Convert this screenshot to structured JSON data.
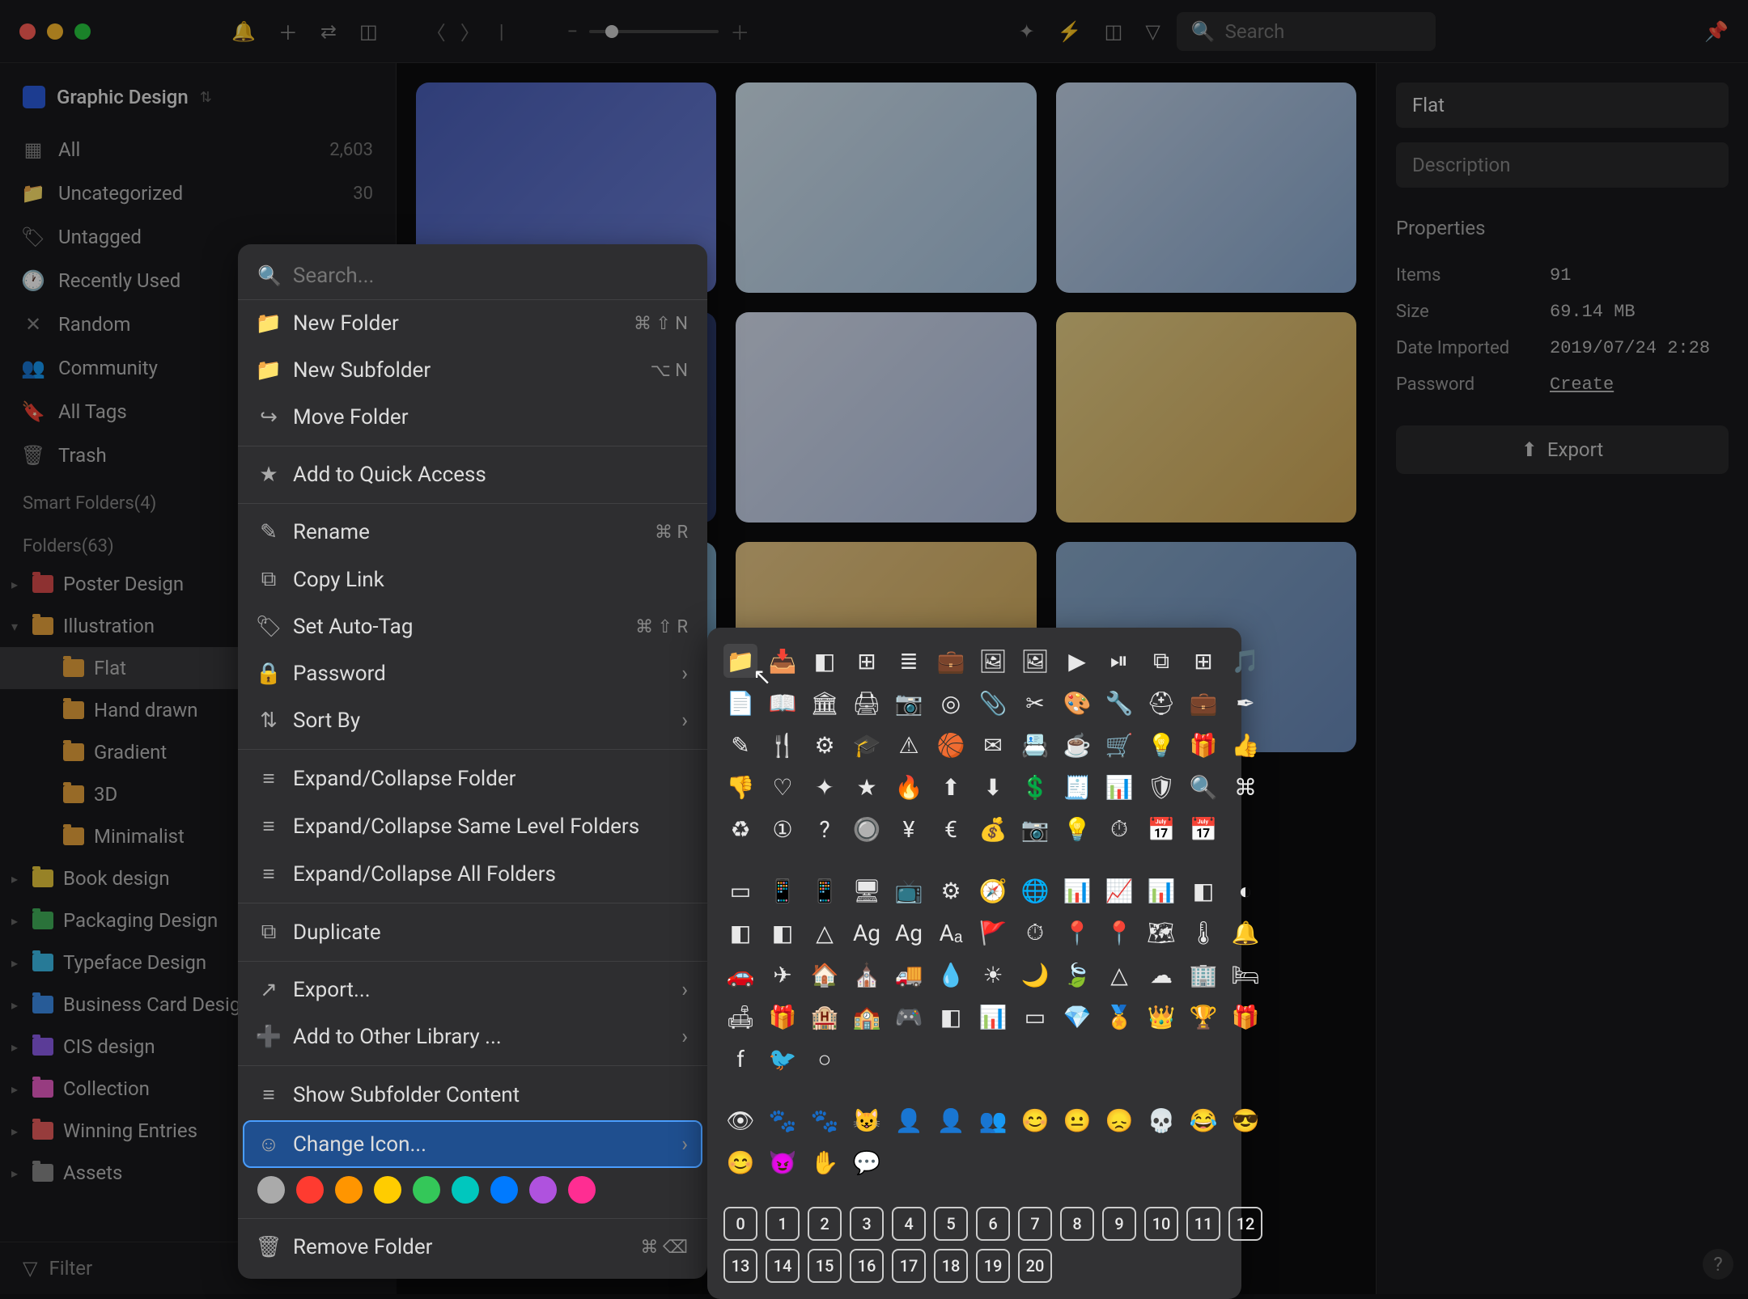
{
  "workspace": {
    "name": "Graphic Design"
  },
  "sidebar": {
    "items": [
      {
        "label": "All",
        "count": "2,603"
      },
      {
        "label": "Uncategorized",
        "count": "30"
      },
      {
        "label": "Untagged",
        "count": ""
      },
      {
        "label": "Recently Used",
        "count": ""
      },
      {
        "label": "Random",
        "count": ""
      },
      {
        "label": "Community",
        "count": ""
      },
      {
        "label": "All Tags",
        "count": ""
      },
      {
        "label": "Trash",
        "count": ""
      }
    ],
    "smart_label": "Smart Folders(4)",
    "folders_label": "Folders(63)",
    "folders": [
      {
        "label": "Poster Design",
        "color": "#d94c4c",
        "nested": false
      },
      {
        "label": "Illustration",
        "color": "#e8a33d",
        "nested": false,
        "expanded": true
      },
      {
        "label": "Flat",
        "color": "#e8a33d",
        "nested": true,
        "selected": true
      },
      {
        "label": "Hand drawn",
        "color": "#e8a33d",
        "nested": true
      },
      {
        "label": "Gradient",
        "color": "#e8a33d",
        "nested": true
      },
      {
        "label": "3D",
        "color": "#e8a33d",
        "nested": true
      },
      {
        "label": "Minimalist",
        "color": "#e8a33d",
        "nested": true
      },
      {
        "label": "Book design",
        "color": "#e8c83d",
        "nested": false
      },
      {
        "label": "Packaging Design",
        "color": "#41b05a",
        "nested": false
      },
      {
        "label": "Typeface Design",
        "color": "#3dbce8",
        "nested": false
      },
      {
        "label": "Business Card Design",
        "color": "#3d8de8",
        "nested": false
      },
      {
        "label": "CIS design",
        "color": "#8c5de8",
        "nested": false
      },
      {
        "label": "Collection",
        "color": "#e85dc5",
        "nested": false
      },
      {
        "label": "Winning Entries",
        "color": "#e85d5d",
        "nested": false
      },
      {
        "label": "Assets",
        "color": "#888",
        "nested": false
      }
    ],
    "filter_label": "Filter"
  },
  "search": {
    "placeholder": "Search"
  },
  "details": {
    "title": "Flat",
    "description_placeholder": "Description",
    "props_head": "Properties",
    "items_k": "Items",
    "items_v": "91",
    "size_k": "Size",
    "size_v": "69.14 MB",
    "date_k": "Date Imported",
    "date_v": "2019/07/24 2:28",
    "pwd_k": "Password",
    "pwd_v": "Create",
    "export_label": "Export"
  },
  "context_menu": {
    "search_placeholder": "Search...",
    "rows": [
      {
        "label": "New Folder",
        "sc": "⌘ ⇧ N"
      },
      {
        "label": "New Subfolder",
        "sc": "⌥ N"
      },
      {
        "label": "Move Folder"
      },
      {
        "sep": true
      },
      {
        "label": "Add to Quick Access"
      },
      {
        "sep": true
      },
      {
        "label": "Rename",
        "sc": "⌘ R"
      },
      {
        "label": "Copy Link"
      },
      {
        "label": "Set Auto-Tag",
        "sc": "⌘ ⇧ R"
      },
      {
        "label": "Password",
        "sub": true
      },
      {
        "label": "Sort By",
        "sub": true
      },
      {
        "sep": true
      },
      {
        "label": "Expand/Collapse Folder"
      },
      {
        "label": "Expand/Collapse Same Level Folders"
      },
      {
        "label": "Expand/Collapse All Folders"
      },
      {
        "sep": true
      },
      {
        "label": "Duplicate"
      },
      {
        "sep": true
      },
      {
        "label": "Export...",
        "sub": true
      },
      {
        "label": "Add to Other Library ...",
        "sub": true
      },
      {
        "sep": true
      },
      {
        "label": "Show Subfolder Content"
      },
      {
        "label": "Change Icon...",
        "sub": true,
        "active": true
      },
      {
        "colors": [
          "#aaa",
          "#ff3b30",
          "#ff9500",
          "#ffcc00",
          "#34c759",
          "#00c7be",
          "#007aff",
          "#af52de",
          "#ff2d92"
        ]
      },
      {
        "sep": true
      },
      {
        "label": "Remove Folder",
        "sc": "⌘ ⌫"
      }
    ],
    "row_icons": [
      "📁",
      "📁",
      "↪",
      "",
      "★",
      "",
      "✎",
      "⧉",
      "🏷",
      "🔒",
      "⇅",
      "",
      "≡",
      "≡",
      "≡",
      "",
      "⧉",
      "",
      "↗",
      "➕",
      "",
      "≡",
      "☺",
      "",
      "",
      "🗑"
    ]
  },
  "icon_picker": {
    "group1": [
      "📁",
      "📥",
      "◧",
      "⊞",
      "≣",
      "💼",
      "🖼",
      "🖼",
      "▶",
      "⏯",
      "⧉",
      "⊞",
      "🎵",
      "📄",
      "📖",
      "🏛",
      "🖨",
      "📷",
      "◎",
      "📎",
      "✂",
      "🎨",
      "🔧",
      "⛑",
      "💼",
      "✒",
      "✎",
      "🍴",
      "⚙",
      "🎓",
      "⚠",
      "🏀",
      "✉",
      "📇",
      "☕",
      "🛒",
      "💡",
      "🎁",
      "👍",
      "👎",
      "♡",
      "✦",
      "★",
      "🔥",
      "⬆",
      "⬇",
      "💲",
      "🧾",
      "📊",
      "🛡",
      "🔍",
      "⌘",
      "♻",
      "①",
      "?",
      "🔘",
      "¥",
      "€",
      "💰",
      "📷",
      "💡",
      "⏱",
      "📅",
      "📅"
    ],
    "group2": [
      "▭",
      "📱",
      "📱",
      "🖥",
      "📺",
      "⚙",
      "🧭",
      "🌐",
      "📊",
      "📈",
      "📊",
      "◧",
      "◐",
      "◧",
      "◧",
      "△",
      "Ag",
      "Ag",
      "Aₐ",
      "🚩",
      "⏱",
      "📍",
      "📍",
      "🗺",
      "🌡",
      "🔔",
      "🚗",
      "✈",
      "🏠",
      "⛪",
      "🚚",
      "💧",
      "☀",
      "🌙",
      "🍃",
      "△",
      "☁",
      "🏢",
      "🛏",
      "🛋",
      "🎁",
      "🏨",
      "🏫",
      "🎮",
      "◧",
      "📊",
      "▭",
      "💎",
      "🏅",
      "👑",
      "🏆",
      "🎁",
      "f",
      "🐦",
      "○"
    ],
    "group3": [
      "👁",
      "🐾",
      "🐾",
      "😺",
      "👤",
      "👤",
      "👥",
      "😊",
      "😐",
      "😞",
      "💀",
      "😂",
      "😎",
      "😊",
      "😈",
      "✋",
      "💬"
    ],
    "numbers": [
      "0",
      "1",
      "2",
      "3",
      "4",
      "5",
      "6",
      "7",
      "8",
      "9",
      "10",
      "11",
      "12",
      "13",
      "14",
      "15",
      "16",
      "17",
      "18",
      "19",
      "20"
    ]
  }
}
